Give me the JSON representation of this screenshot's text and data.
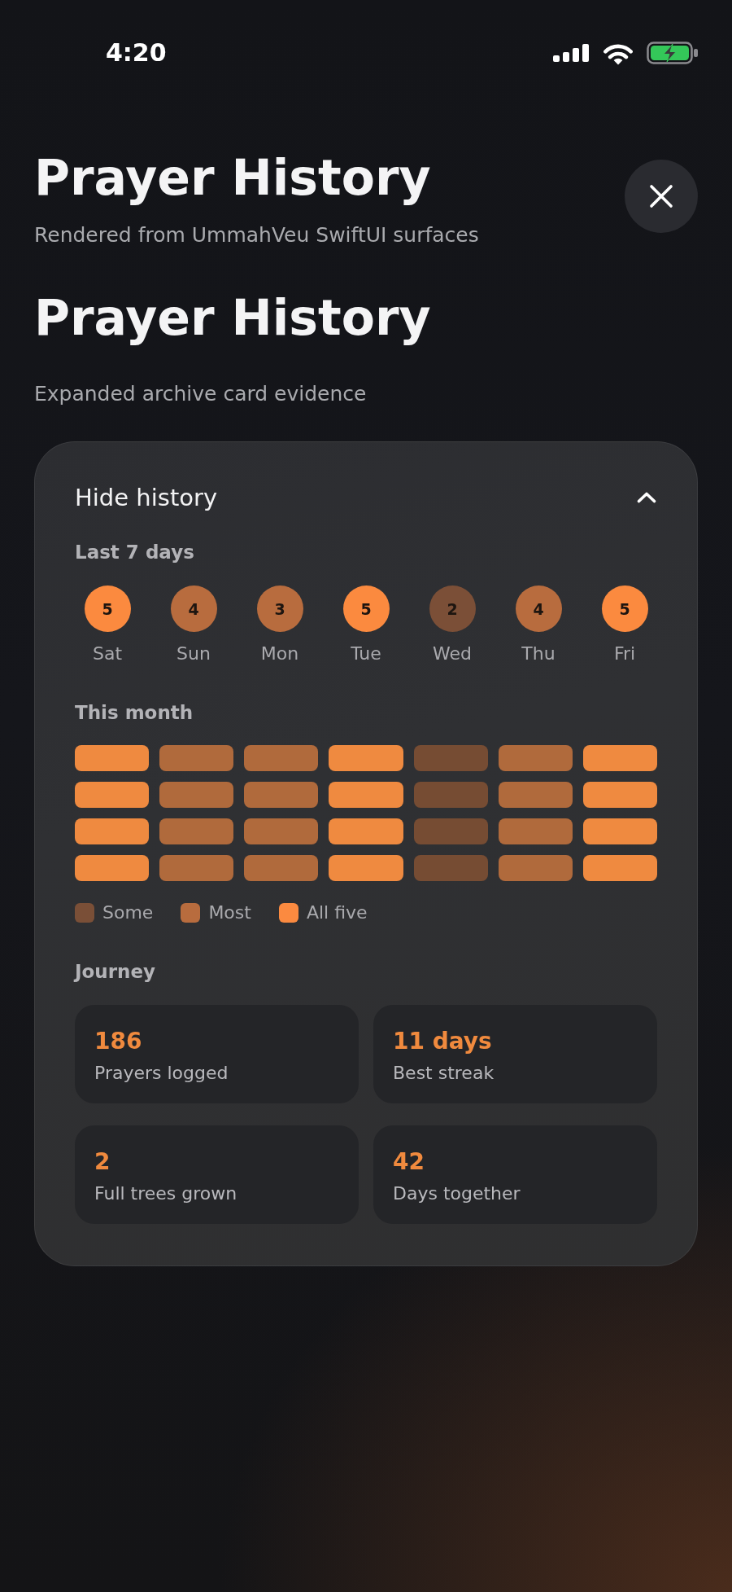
{
  "status_bar": {
    "time": "4:20"
  },
  "header": {
    "title": "Prayer History",
    "subtitle": "Rendered from UmmahVeu SwiftUI surfaces"
  },
  "section": {
    "title": "Prayer History",
    "subtitle": "Expanded archive card evidence"
  },
  "history_card": {
    "toggle_label": "Hide history",
    "expanded": true,
    "last_7_days": {
      "title": "Last 7 days",
      "days": [
        {
          "count": "5",
          "label": "Sat",
          "color": "#fb8a3f"
        },
        {
          "count": "4",
          "label": "Sun",
          "color": "#b86c3e"
        },
        {
          "count": "3",
          "label": "Mon",
          "color": "#b86c3e"
        },
        {
          "count": "5",
          "label": "Tue",
          "color": "#fb8a3f"
        },
        {
          "count": "2",
          "label": "Wed",
          "color": "#7b4f37"
        },
        {
          "count": "4",
          "label": "Thu",
          "color": "#b86c3e"
        },
        {
          "count": "5",
          "label": "Fri",
          "color": "#fb8a3f"
        }
      ]
    },
    "this_month": {
      "title": "This month",
      "weeks": [
        {
          "days": [
            {
              "color": "#ef8a40"
            },
            {
              "color": "#b06a3c"
            },
            {
              "color": "#b06a3c"
            },
            {
              "color": "#ef8a40"
            },
            {
              "color": "#764c33"
            },
            {
              "color": "#b06a3c"
            },
            {
              "color": "#ef8a40"
            }
          ]
        },
        {
          "days": [
            {
              "color": "#ef8a40"
            },
            {
              "color": "#b06a3c"
            },
            {
              "color": "#b06a3c"
            },
            {
              "color": "#ef8a40"
            },
            {
              "color": "#764c33"
            },
            {
              "color": "#b06a3c"
            },
            {
              "color": "#ef8a40"
            }
          ]
        },
        {
          "days": [
            {
              "color": "#ef8a40"
            },
            {
              "color": "#b06a3c"
            },
            {
              "color": "#b06a3c"
            },
            {
              "color": "#ef8a40"
            },
            {
              "color": "#764c33"
            },
            {
              "color": "#b06a3c"
            },
            {
              "color": "#ef8a40"
            }
          ]
        },
        {
          "days": [
            {
              "color": "#ef8a40"
            },
            {
              "color": "#b06a3c"
            },
            {
              "color": "#b06a3c"
            },
            {
              "color": "#ef8a40"
            },
            {
              "color": "#764c33"
            },
            {
              "color": "#b06a3c"
            },
            {
              "color": "#ef8a40"
            }
          ]
        }
      ],
      "legend": [
        {
          "label": "Some",
          "color": "#7a4f37"
        },
        {
          "label": "Most",
          "color": "#b86c3e"
        },
        {
          "label": "All five",
          "color": "#fb8a40"
        }
      ]
    },
    "journey": {
      "title": "Journey",
      "stats": [
        {
          "value": "186",
          "label": "Prayers logged"
        },
        {
          "value": "11 days",
          "label": "Best streak"
        },
        {
          "value": "2",
          "label": "Full trees grown"
        },
        {
          "value": "42",
          "label": "Days together"
        }
      ]
    }
  }
}
